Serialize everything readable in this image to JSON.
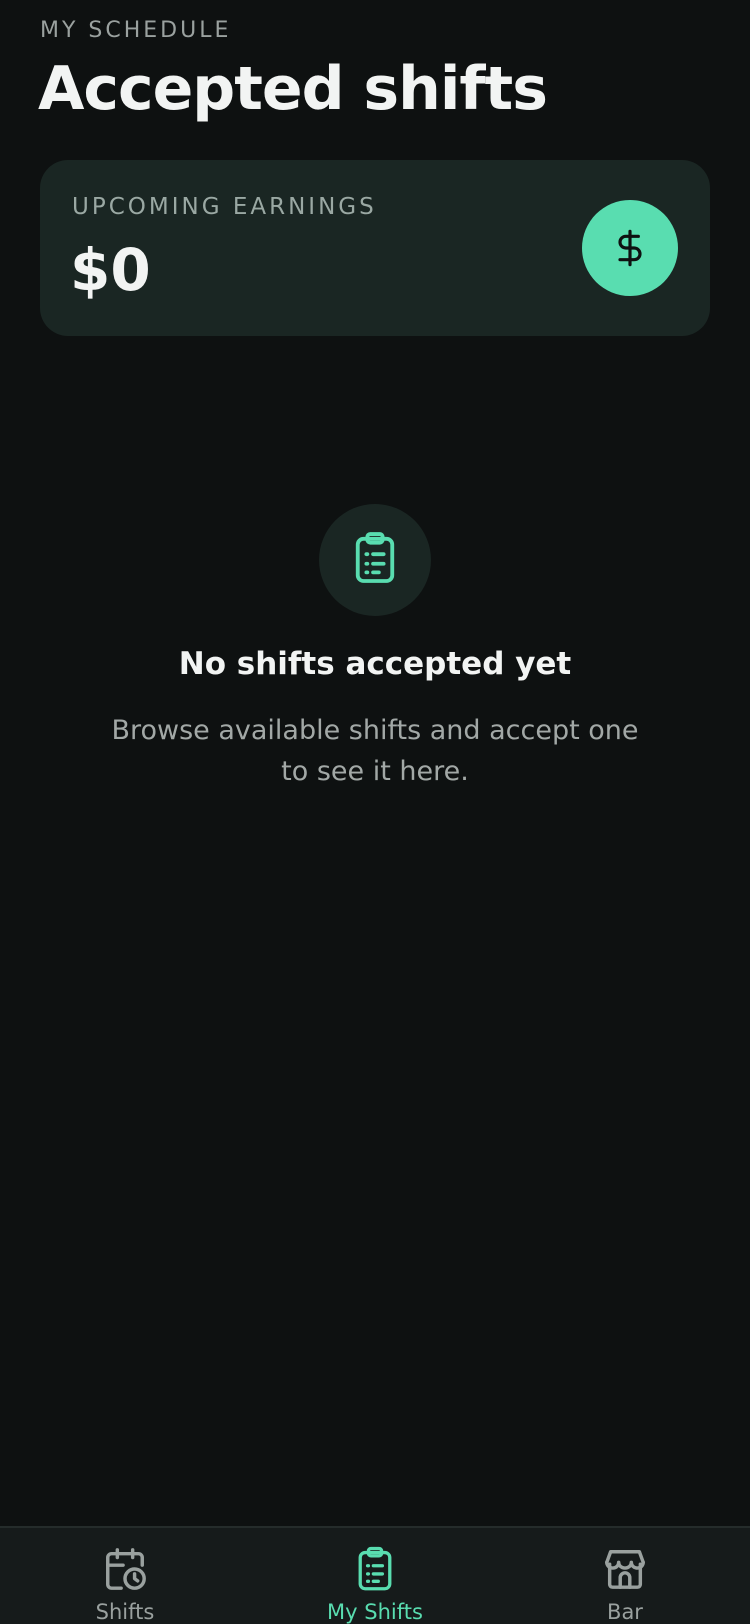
{
  "header": {
    "eyebrow": "MY SCHEDULE",
    "title": "Accepted shifts"
  },
  "earnings": {
    "label": "UPCOMING EARNINGS",
    "value": "$0",
    "icon": "dollar-icon"
  },
  "empty_state": {
    "icon": "clipboard-list-icon",
    "title": "No shifts accepted yet",
    "description": "Browse available shifts and accept one to see it here."
  },
  "tabs": [
    {
      "label": "Shifts",
      "icon": "calendar-clock-icon",
      "active": false
    },
    {
      "label": "My Shifts",
      "icon": "clipboard-list-icon",
      "active": true
    },
    {
      "label": "Bar",
      "icon": "storefront-icon",
      "active": false
    }
  ],
  "colors": {
    "background": "#0e1111",
    "card": "#1a2623",
    "accent": "#59ddb0",
    "tab_inactive": "#9aa19f"
  }
}
